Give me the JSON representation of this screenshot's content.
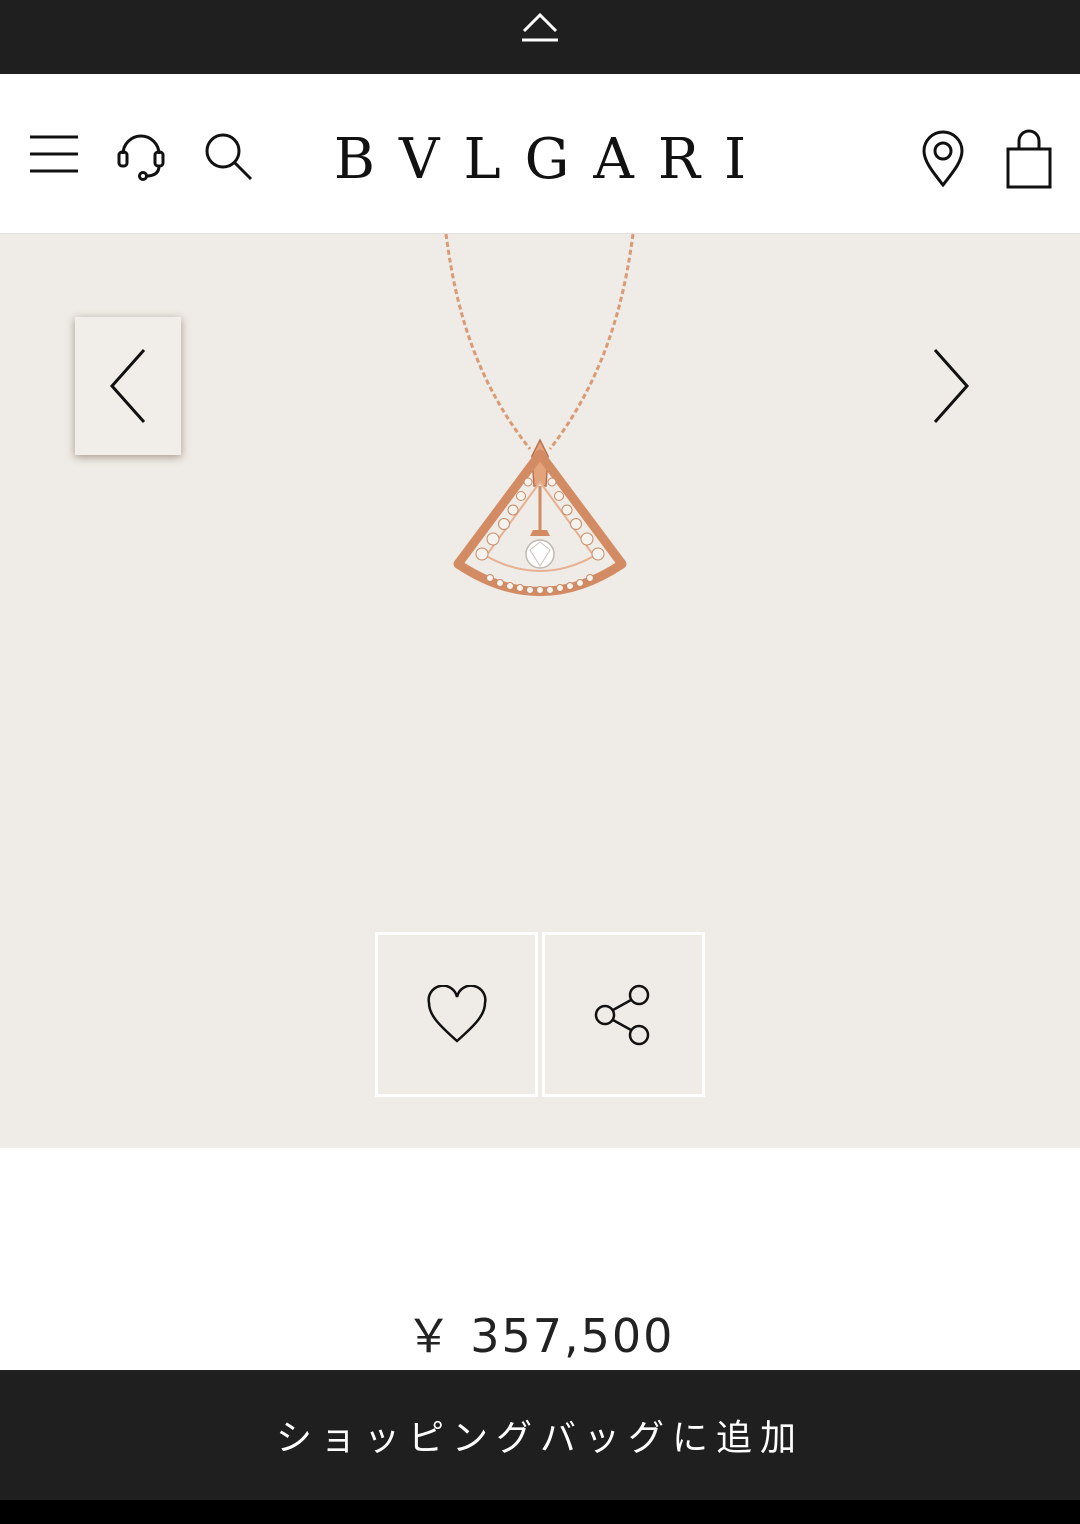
{
  "header": {
    "brand": "BVLGARI",
    "icons": [
      "menu-icon",
      "headset-icon",
      "search-icon",
      "location-pin-icon",
      "shopping-bag-icon"
    ]
  },
  "top_strip": {
    "icon": "chevron-up-icon"
  },
  "gallery": {
    "prev_icon": "chevron-left-icon",
    "next_icon": "chevron-right-icon",
    "actions": [
      "heart-icon",
      "share-icon"
    ]
  },
  "product": {
    "price": "￥ 357,500"
  },
  "cta": {
    "add_to_bag_label": "ショッピングバッグに追加"
  },
  "colors": {
    "dark_bar": "#1f1f1f",
    "gallery_bg": "#efebe6",
    "rose_gold": "#d9906b"
  }
}
